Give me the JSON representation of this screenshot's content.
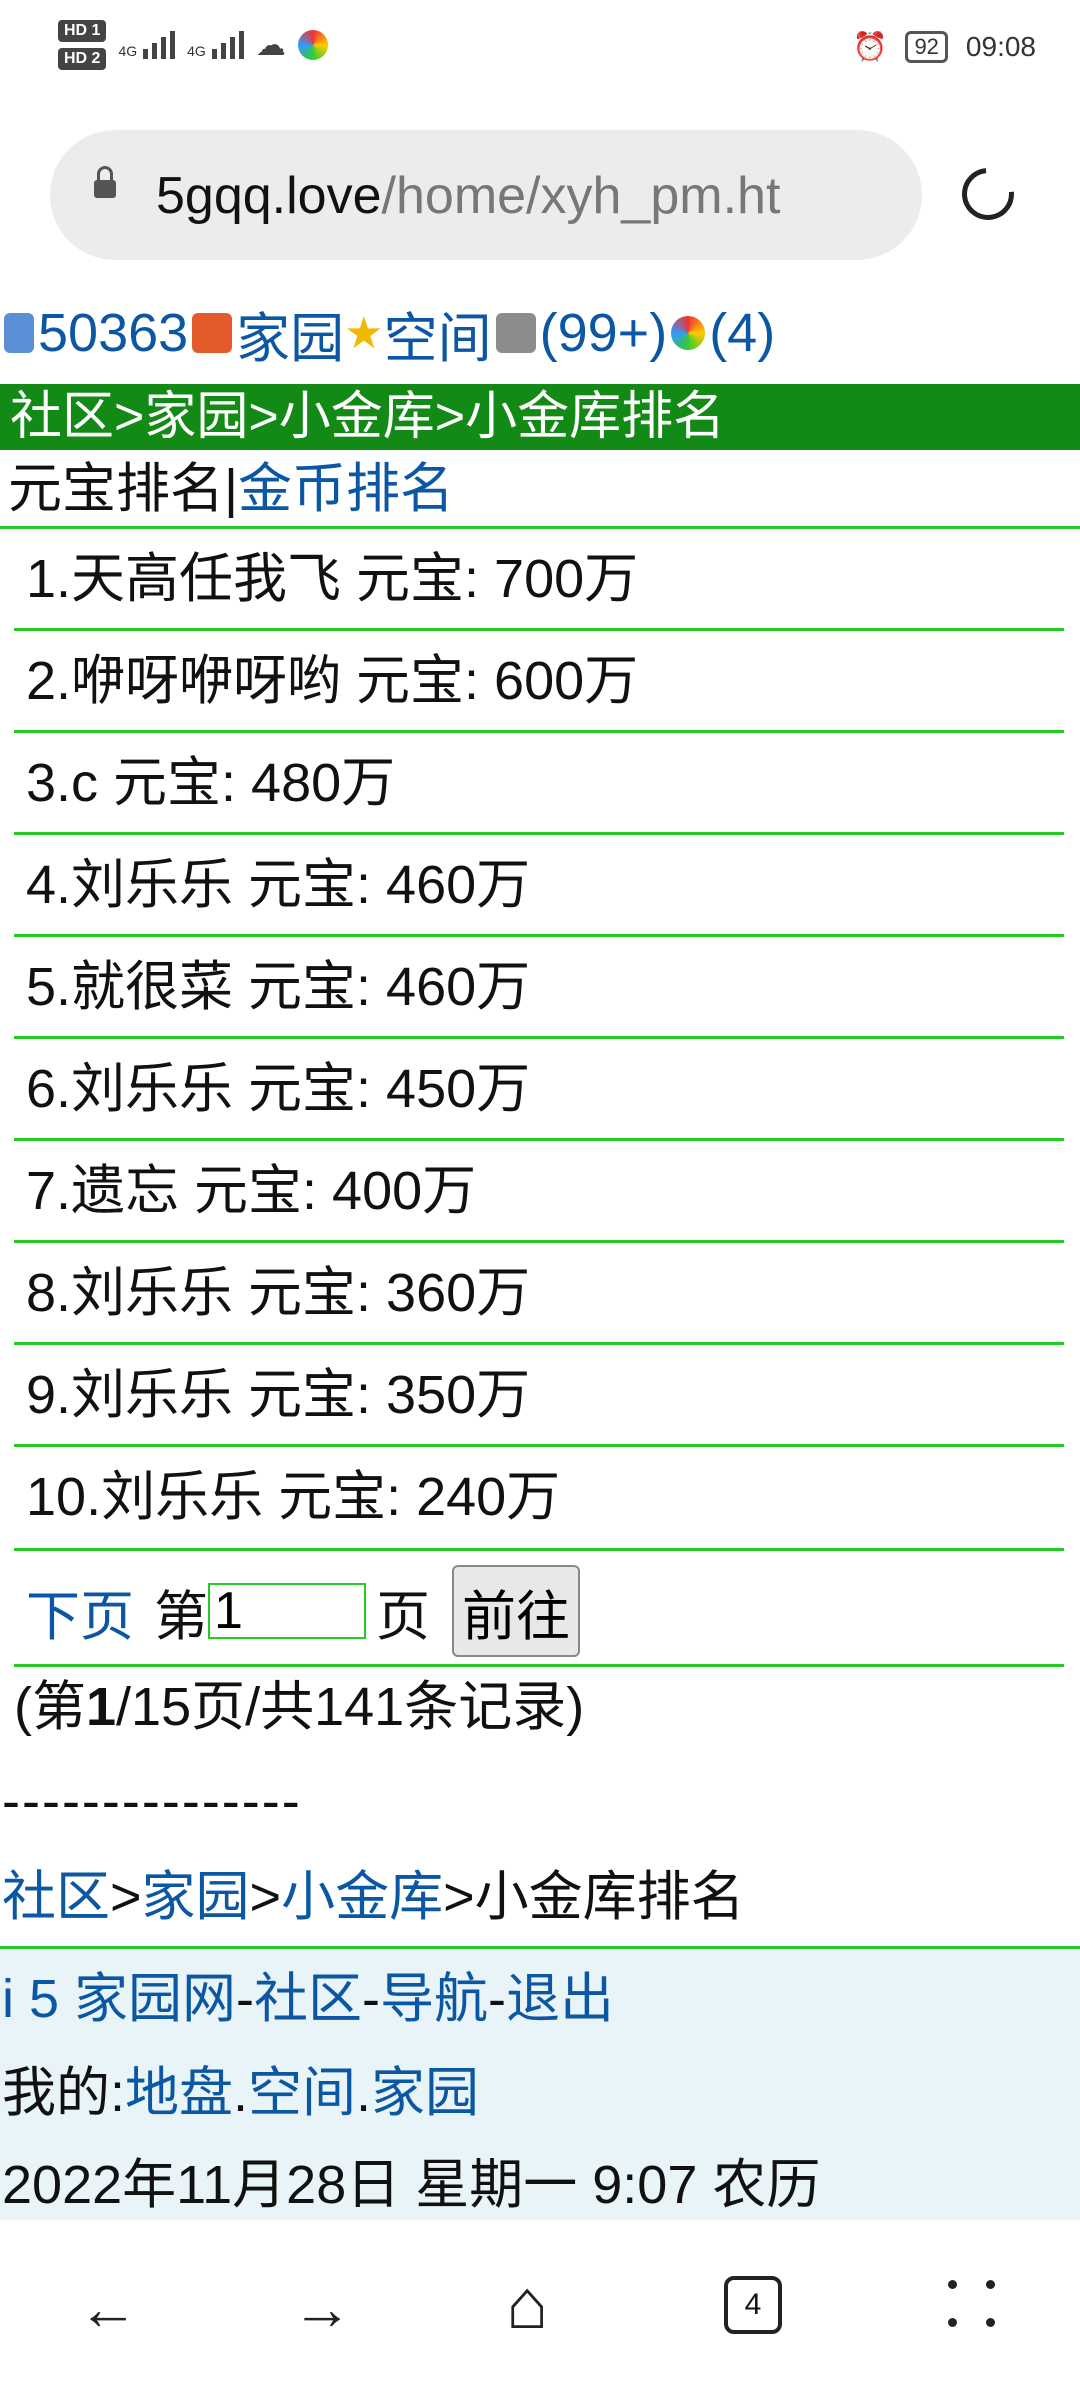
{
  "status": {
    "hd1": "HD 1",
    "hd2": "HD 2",
    "sig1": "4G",
    "sig2": "4G",
    "battery": "92",
    "time": "09:08"
  },
  "browser": {
    "url_host": "5gqq.love",
    "url_path": "/home/xyh_pm.ht"
  },
  "top": {
    "user_id": "50363",
    "home_label": "家园",
    "space_label": "空间",
    "msg_count": "(99+)",
    "other_count": "(4)"
  },
  "header": {
    "breadcrumb": "社区>家园>小金库>小金库排名"
  },
  "tabs": {
    "current": "元宝排名",
    "sep": "|",
    "other": "金币排名"
  },
  "ranking": [
    "1.天高任我飞 元宝: 700万",
    "2.咿呀咿呀哟 元宝: 600万",
    "3.c 元宝: 480万",
    "4.刘乐乐 元宝: 460万",
    "5.就很菜 元宝: 460万",
    "6.刘乐乐 元宝: 450万",
    "7.遗忘 元宝: 400万",
    "8.刘乐乐 元宝: 360万",
    "9.刘乐乐 元宝: 350万",
    "10.刘乐乐 元宝: 240万"
  ],
  "pager": {
    "next": "下页",
    "pre": "第",
    "page_value": "1",
    "post": "页",
    "go": "前往"
  },
  "records": {
    "open": "(第",
    "current": "1",
    "rest": "/15页/共141条记录)"
  },
  "divider": "---------------",
  "crumb": {
    "a": "社区",
    "b": "家园",
    "c": "小金库",
    "sep": ">",
    "last": "小金库排名"
  },
  "footer": {
    "site": "i 5 家园网",
    "community": "社区",
    "nav": "导航",
    "logout": "退出",
    "dash": "-",
    "mine": "我的:",
    "land": "地盘",
    "space": "空间",
    "home": "家园",
    "dot": ".",
    "date": "2022年11月28日  星期一  9:07  农历"
  },
  "nav": {
    "back": "←",
    "forward": "→",
    "home": "⌂",
    "tabs": "4"
  }
}
